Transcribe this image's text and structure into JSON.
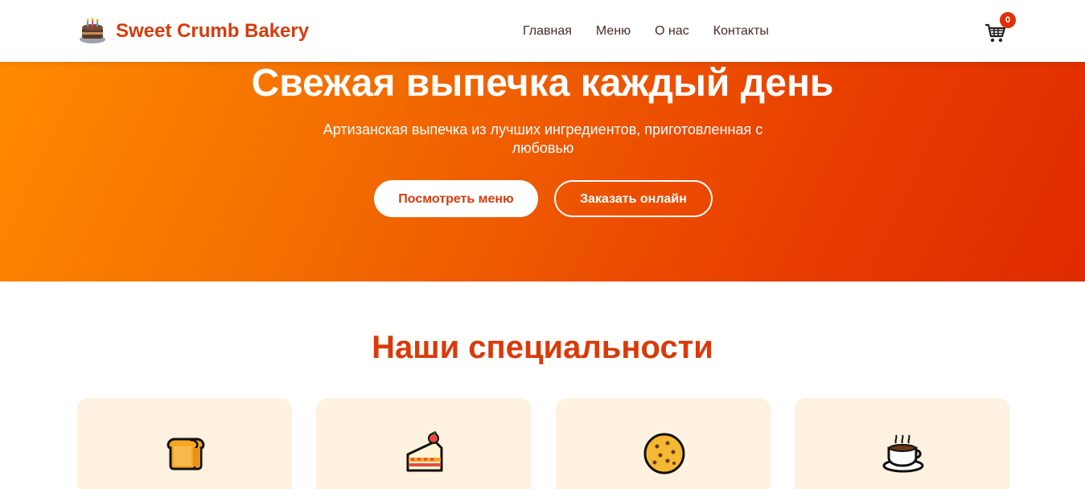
{
  "header": {
    "brand": "Sweet Crumb Bakery",
    "logo_icon": "cake-icon",
    "nav": [
      {
        "label": "Главная"
      },
      {
        "label": "Меню"
      },
      {
        "label": "О нас"
      },
      {
        "label": "Контакты"
      }
    ],
    "cart": {
      "icon": "cart-icon",
      "count": "0"
    }
  },
  "hero": {
    "title": "Свежая выпечка каждый день",
    "subtitle": "Артизанская выпечка из лучших ингредиентов, приготовленная с любовью",
    "primary_button": "Посмотреть меню",
    "secondary_button": "Заказать онлайн"
  },
  "specialties": {
    "title": "Наши специальности",
    "cards": [
      {
        "icon": "bread-icon"
      },
      {
        "icon": "cake-slice-icon"
      },
      {
        "icon": "cookie-icon"
      },
      {
        "icon": "coffee-icon"
      }
    ]
  },
  "colors": {
    "accent": "#d93a0a",
    "hero_start": "#ff8a00",
    "hero_end": "#e02a00",
    "card_bg": "#fff1df",
    "badge": "#e02f04"
  }
}
